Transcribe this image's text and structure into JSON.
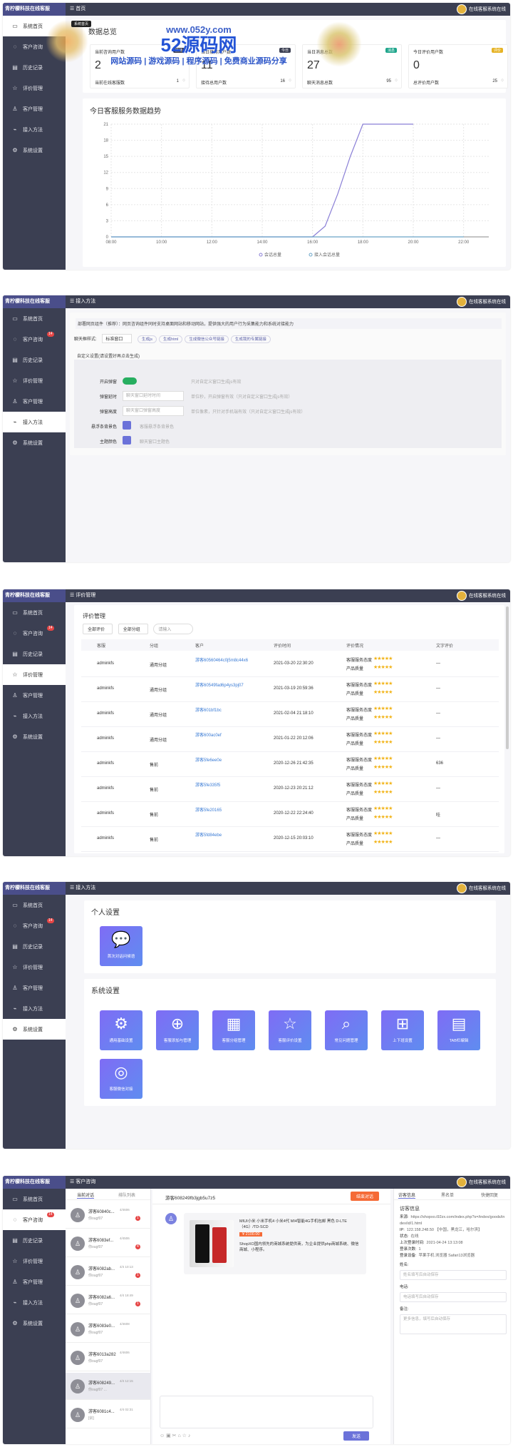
{
  "brand": "青柠檬科技在线客服",
  "online_status": "在线客服系统在线",
  "nav": {
    "home": "系统首页",
    "consult": "客户咨询",
    "consult_badge": "14",
    "history": "历史记录",
    "eval": "评价管理",
    "customer": "客户管理",
    "access": "接入方法",
    "settings": "系统设置"
  },
  "watermark": {
    "url": "www.052y.com",
    "name": "52源码网",
    "tagline": "网站源码 | 游戏源码 | 程序源码 | 免费商业源码分享"
  },
  "s1": {
    "crumb": "首页",
    "tooltip": "系统首页",
    "title": "数据总览",
    "cards": [
      {
        "label": "当前咨询用户数",
        "badge": "接待",
        "value": "2",
        "sub": "当前在线客服数",
        "subval": "1"
      },
      {
        "label": "当日接待用户数",
        "badge": "今日",
        "value": "11",
        "sub": "接待总用户数",
        "subval": "16"
      },
      {
        "label": "当日消息总数",
        "badge": "消息",
        "value": "27",
        "sub": "聊天消息总数",
        "subval": "95"
      },
      {
        "label": "今日评价用户数",
        "badge": "评价",
        "value": "0",
        "sub": "总评价用户数",
        "subval": "25"
      }
    ],
    "chart_title": "今日客服服务数据趋势"
  },
  "chart_data": {
    "type": "line",
    "title": "今日客服服务数据趋势",
    "x": [
      "08:00",
      "10:00",
      "12:00",
      "14:00",
      "16:00",
      "18:00",
      "20:00",
      "22:00"
    ],
    "series": [
      {
        "name": "会话总量",
        "points": [
          [
            8,
            0
          ],
          [
            16,
            0
          ],
          [
            16.5,
            2
          ],
          [
            17,
            8
          ],
          [
            17.5,
            15
          ],
          [
            18,
            21
          ],
          [
            20,
            21
          ]
        ]
      },
      {
        "name": "接入会话总量",
        "points": [
          [
            8,
            0
          ],
          [
            22,
            0
          ]
        ]
      }
    ],
    "yticks": [
      0,
      3,
      6,
      9,
      12,
      15,
      18,
      21
    ],
    "ylim": [
      0,
      21
    ],
    "xlim": [
      8,
      23
    ],
    "legend": "bottom",
    "grid": true
  },
  "s2": {
    "crumb": "接入方法",
    "notice": "部署网页组件（推荐）：网页咨询组件同时支持桌面网站和移动网站，提供强大的用户行为采集能力和系统对接能力",
    "style_label": "聊天框样式:",
    "style_value": "标准窗口",
    "chips": [
      "生成js",
      "生成html",
      "生成微信公众号链接",
      "生成我的专属链接"
    ],
    "custom_title": "自定义设置(请设置好再点击生成)",
    "rows": [
      {
        "label": "开启弹窗",
        "value": "",
        "hint": "只对自定义窗口生成js有效"
      },
      {
        "label": "弹窗延时",
        "value": "聊天窗口延时时间",
        "hint": "单位秒，开启弹窗有效（只对自定义窗口生成js有效）"
      },
      {
        "label": "弹窗高度",
        "value": "聊天窗口弹窗高度",
        "hint": "单位像素，只针对手机端有效（只对自定义窗口生成js有效）"
      },
      {
        "label": "悬浮条背景色",
        "value": "",
        "hint": "客服悬浮条背景色"
      },
      {
        "label": "主题颜色",
        "value": "",
        "hint": "聊天窗口主题色"
      }
    ]
  },
  "s3": {
    "crumb": "评价管理",
    "title": "评价管理",
    "filter1": "全部评价",
    "filter2": "全部分组",
    "search_ph": "请输入",
    "headers": [
      "客服",
      "分组",
      "客户",
      "评价时间",
      "评价情况",
      "文字评价"
    ],
    "rate_a": "客服服务态度",
    "rate_b": "产品质量",
    "stars": "★★★★★",
    "rows": [
      {
        "agent": "adminkfs",
        "group": "通用分组",
        "customer": "游客60560464c0j5m8c44x6",
        "time": "2021-03-20 22:30:20",
        "text": "—"
      },
      {
        "agent": "adminkfs",
        "group": "通用分组",
        "customer": "游客60549fad6p4ys3pj07",
        "time": "2021-03-19 20:59:36",
        "text": "—"
      },
      {
        "agent": "adminkfs",
        "group": "通用分组",
        "customer": "游客601bf1bc",
        "time": "2021-02-04 21:18:10",
        "text": "—"
      },
      {
        "agent": "adminkfs",
        "group": "通用分组",
        "customer": "游客600ac0ef",
        "time": "2021-01-22 20:12:06",
        "text": "—"
      },
      {
        "agent": "adminkfs",
        "group": "售前",
        "customer": "游客5fe6ee0e",
        "time": "2020-12-26 21:42:35",
        "text": "636"
      },
      {
        "agent": "adminkfs",
        "group": "售前",
        "customer": "游客5fe335f5",
        "time": "2020-12-23 20:21:12",
        "text": "—"
      },
      {
        "agent": "adminkfs",
        "group": "售前",
        "customer": "游客5fe20165",
        "time": "2020-12-22 22:24:40",
        "text": "哇"
      },
      {
        "agent": "adminkfs",
        "group": "售前",
        "customer": "游客5fd84ebe",
        "time": "2020-12-15 20:03:10",
        "text": "—"
      }
    ]
  },
  "s4": {
    "crumb": "接入方法",
    "personal_title": "个人设置",
    "personal_tile": "首次对话问候语",
    "system_title": "系统设置",
    "tiles": [
      "通用基础设置",
      "客服添加与管理",
      "客服分组管理",
      "客服评价设置",
      "常见问题管理",
      "上下班设置",
      "TAB栏编辑",
      "客服微信对接"
    ]
  },
  "s5": {
    "crumb": "客户咨询",
    "tab_current": "当前对话",
    "tab_queue": "排队列表",
    "chat_title": "游客608249fb3jgb5u7z5",
    "end_btn": "结束对话",
    "convs": [
      {
        "name": "游客60840c...",
        "time": "4/4606",
        "msg": "你ougf07",
        "badge": "1"
      },
      {
        "name": "游客6083ef...",
        "time": "4/4506",
        "msg": "你ougf07",
        "badge": "4"
      },
      {
        "name": "游客6082ab...",
        "time": "4/4 10:13",
        "msg": "你ougf07",
        "badge": "1"
      },
      {
        "name": "游客6082a6...",
        "time": "4/4 18:49",
        "msg": "你ougf07",
        "badge": "1"
      },
      {
        "name": "游客6083e0...",
        "time": "4/4608",
        "msg": "你ougf07",
        "badge": ""
      },
      {
        "name": "游客6013a282",
        "time": "4/4606",
        "msg": "你ougf07",
        "badge": ""
      },
      {
        "name": "游客608249...",
        "time": "4/4 12:15",
        "msg": "你ougf07 ...",
        "badge": ""
      },
      {
        "name": "游客6081c4...",
        "time": "4/4 02:31",
        "msg": "[训]",
        "badge": ""
      }
    ],
    "product_name": "MIUI小米 小米手机4 小米4代 MI4智能4G手机包邮 黑色 D-LTE（4G）/TD-SCD",
    "product_price": "¥ 2100.00",
    "product_desc": "ShopXO国内领先的商城系统提供商，为企业提供php商城系统、微信商城、小程序。",
    "send": "发送",
    "right_tabs": [
      "访客信息",
      "黑名单",
      "快捷回复"
    ],
    "info_title": "访客信息",
    "info": [
      {
        "k": "来源:",
        "v": "https://shopxo.i92zx.com/index.php?s=/index/goods/index/id/1.html"
      },
      {
        "k": "IP:",
        "v": "122.158.248.50 【中国，黑龙江，哈尔滨】"
      },
      {
        "k": "状态:",
        "v": "在线"
      },
      {
        "k": "上次登录时间:",
        "v": "2021-04-24 13:13:08"
      },
      {
        "k": "登录次数:",
        "v": "1"
      },
      {
        "k": "登录设备:",
        "v": "苹果手机 浏览器 Safari13浏览器"
      }
    ],
    "name_label": "姓名:",
    "name_ph": "姓名填写后自动保存",
    "phone_label": "电话:",
    "phone_ph": "电话填写后自动保存",
    "note_label": "备注:",
    "note_ph": "更多信息，填写后自动保存"
  }
}
